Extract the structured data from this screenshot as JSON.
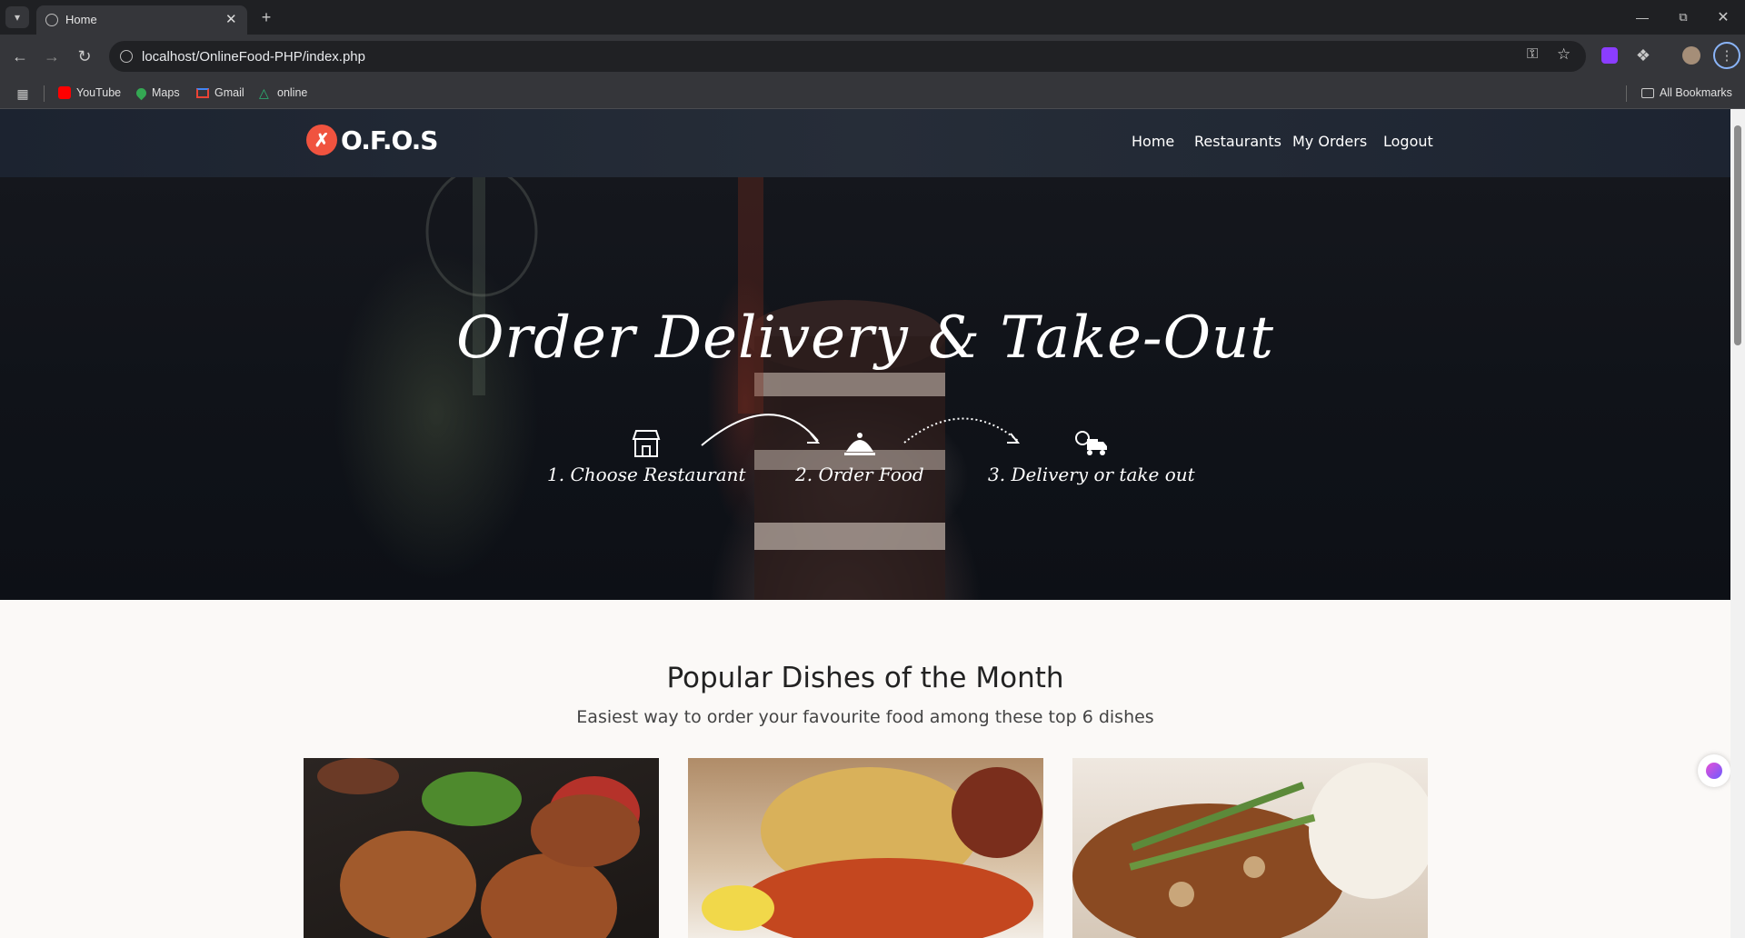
{
  "browser": {
    "tab_title": "Home",
    "url": "localhost/OnlineFood-PHP/index.php",
    "bookmarks": [
      {
        "label": "YouTube",
        "icon": "youtube-icon",
        "color": "#ff0000"
      },
      {
        "label": "Maps",
        "icon": "maps-icon",
        "color": "#34a853"
      },
      {
        "label": "Gmail",
        "icon": "gmail-icon",
        "color": "#ea4335"
      },
      {
        "label": "online",
        "icon": "online-icon",
        "color": "#2bb673"
      }
    ],
    "all_bookmarks": "All Bookmarks"
  },
  "site": {
    "logo_text": "O.F.O.S",
    "brand_color": "#f0533f",
    "nav": [
      {
        "label": "Home"
      },
      {
        "label": "Restaurants"
      },
      {
        "label": "My Orders"
      },
      {
        "label": "Logout"
      }
    ],
    "hero": {
      "title": "Order Delivery & Take-Out",
      "steps": [
        {
          "label": "1. Choose Restaurant",
          "icon": "storefront-icon"
        },
        {
          "label": "2. Order Food",
          "icon": "cloche-icon"
        },
        {
          "label": "3. Delivery or take out",
          "icon": "delivery-truck-icon"
        }
      ]
    },
    "popular": {
      "title": "Popular Dishes of the Month",
      "subtitle": "Easiest way to order your favourite food among these top 6 dishes",
      "dishes": [
        {
          "image": "grilled-burger-patties-image"
        },
        {
          "image": "lobster-thermidor-image"
        },
        {
          "image": "chicken-marsala-image"
        }
      ]
    }
  }
}
